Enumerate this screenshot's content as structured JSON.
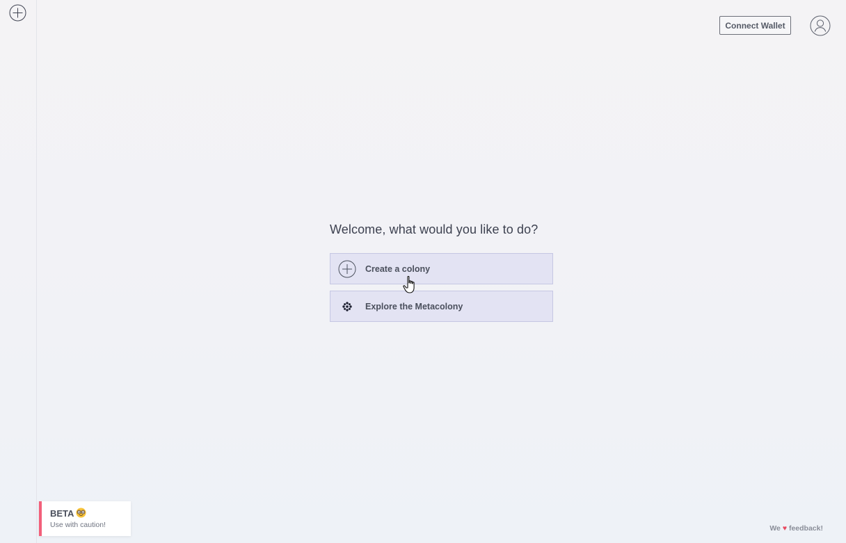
{
  "sidebar": {
    "add_icon": "plus-circle-icon"
  },
  "header": {
    "connect_wallet_label": "Connect Wallet",
    "avatar_icon": "user-avatar-icon"
  },
  "main": {
    "welcome_text": "Welcome, what would you like to do?",
    "actions": [
      {
        "label": "Create a colony",
        "icon": "plus-circle-icon"
      },
      {
        "label": "Explore the Metacolony",
        "icon": "metacolony-icon"
      }
    ]
  },
  "beta_banner": {
    "title": "BETA",
    "emoji": "nerd-face",
    "subtitle": "Use with caution!",
    "accent_color": "#f25f7a"
  },
  "feedback": {
    "prefix": "We",
    "heart": "♥",
    "suffix": "feedback!"
  },
  "colors": {
    "button_bg": "#e3e3f3",
    "button_border": "#c5c7e3",
    "text": "#3d4150"
  }
}
